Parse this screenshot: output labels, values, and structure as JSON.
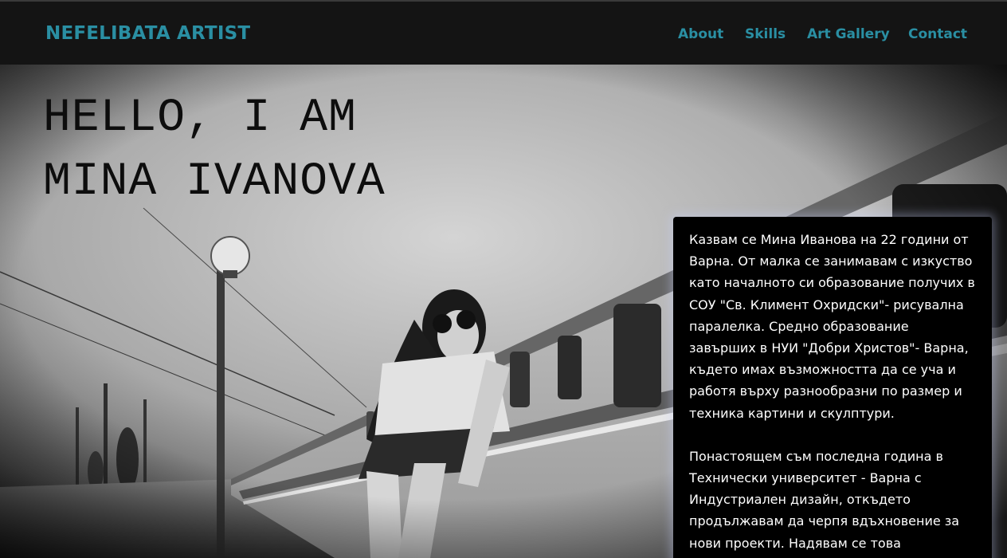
{
  "navbar": {
    "brand": "NEFELIBATA ARTIST",
    "links": [
      "About",
      "Skills",
      "Art Gallery",
      "Contact"
    ],
    "accent_color": "#2a8fa3",
    "background": "#141414"
  },
  "hero": {
    "title_line1": "HELLO, I AM",
    "title_line2": "MINA IVANOVA",
    "photo": "black-and-white photo of a woman in sunglasses leaning forward on a train platform"
  },
  "bio": {
    "paragraph1": "Казвам се Мина Иванова на 22 години от Варна. От малка се занимавам с изкуство като началното си образование получих в СОУ \"Св. Климент Охридски\"- рисувална паралелка. Средно образование завърших в НУИ \"Добри Христов\"- Варна, където имах възможността да се уча и работя върху разнообразни по размер и техника картини и скулптури.",
    "paragraph2": "Понастоящем съм последна година в Технически университет - Варна с Индустриален дизайн, откъдето продължавам да черпя вдъхновение за нови проекти. Надявам се това"
  }
}
